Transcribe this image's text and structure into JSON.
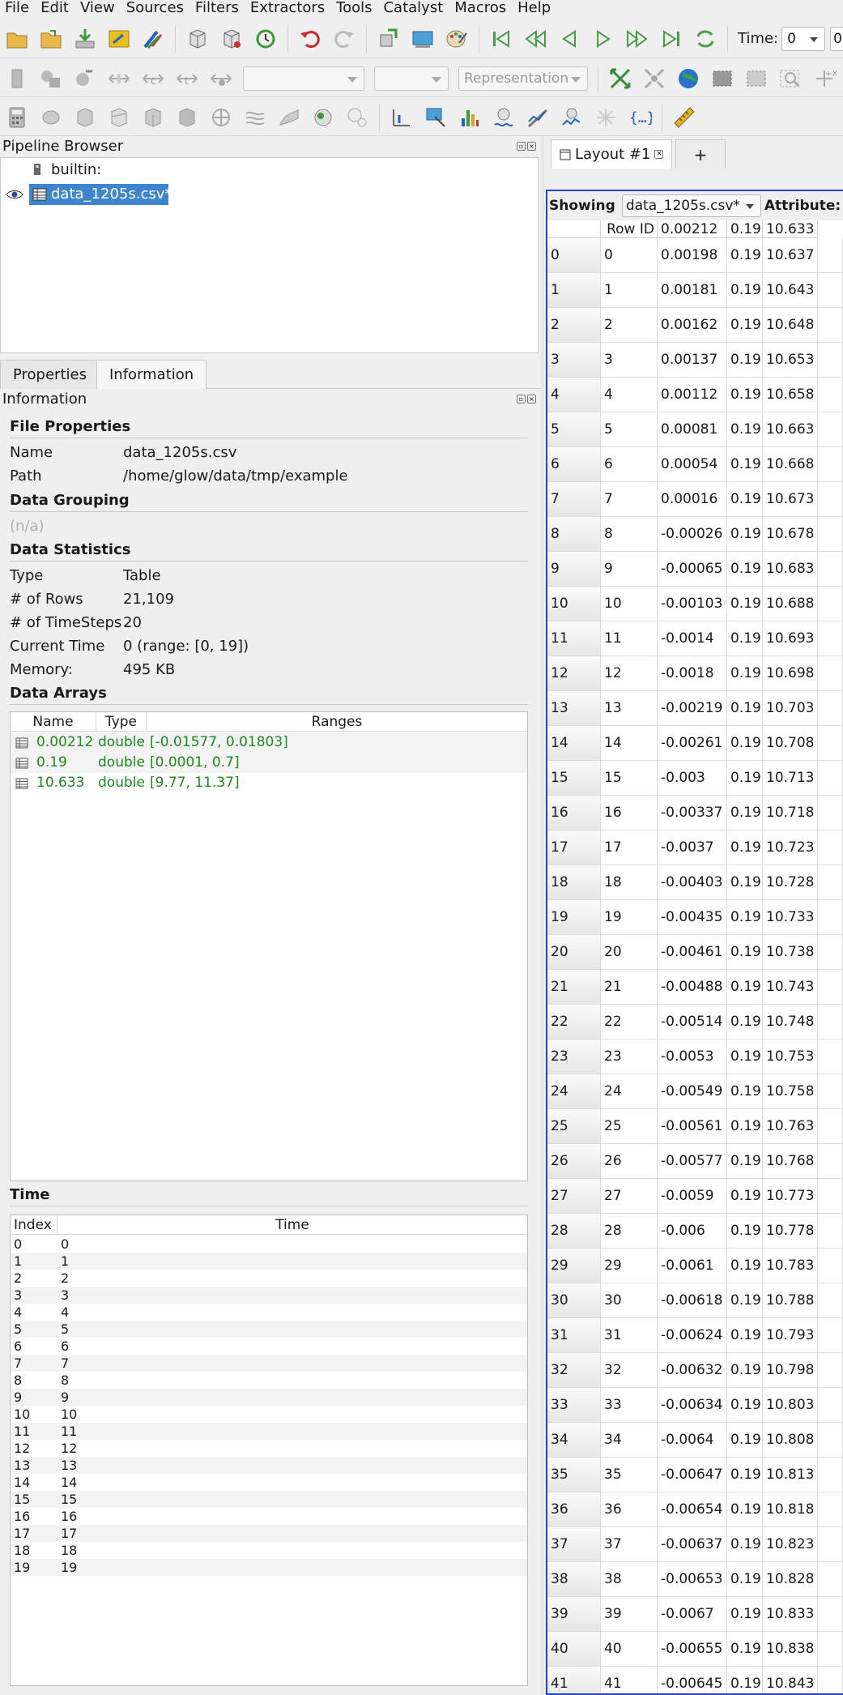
{
  "menu": [
    "File",
    "Edit",
    "View",
    "Sources",
    "Filters",
    "Extractors",
    "Tools",
    "Catalyst",
    "Macros",
    "Help"
  ],
  "toolbar": {
    "time_label": "Time:",
    "time_value": "0",
    "time_spin_value": "0",
    "representation_placeholder": "Representation"
  },
  "colors": {
    "accent_blue": "#2040d0",
    "selection": "#3d86cf",
    "array_green": "#1a8a1a",
    "undo_red": "#cc2a2a"
  },
  "pipeline": {
    "title": "Pipeline Browser",
    "items": [
      {
        "label": "builtin:"
      },
      {
        "label": "data_1205s.csv*"
      }
    ]
  },
  "tabs": [
    "Properties",
    "Information"
  ],
  "information": {
    "title": "Information",
    "file_properties": {
      "title": "File Properties",
      "name_key": "Name",
      "name_value": "data_1205s.csv",
      "path_key": "Path",
      "path_value": "/home/glow/data/tmp/example"
    },
    "data_grouping": {
      "title": "Data Grouping",
      "value": "(n/a)"
    },
    "data_statistics": {
      "title": "Data Statistics",
      "rows": [
        {
          "key": "Type",
          "value": "Table"
        },
        {
          "key": "# of Rows",
          "value": "21,109"
        },
        {
          "key": "# of TimeSteps",
          "value": "20"
        },
        {
          "key": "Current Time",
          "value": "0 (range: [0, 19])"
        },
        {
          "key": "Memory:",
          "value": "495 KB"
        }
      ]
    },
    "data_arrays": {
      "title": "Data Arrays",
      "headers": [
        "Name",
        "Type",
        "Ranges"
      ],
      "rows": [
        {
          "name": "0.00212",
          "type": "double",
          "range": "[-0.01577, 0.01803]"
        },
        {
          "name": "0.19",
          "type": "double",
          "range": "[0.0001, 0.7]"
        },
        {
          "name": "10.633",
          "type": "double",
          "range": "[9.77, 11.37]"
        }
      ]
    },
    "time": {
      "title": "Time",
      "headers": [
        "Index",
        "Time"
      ],
      "rows": [
        [
          "0",
          "0"
        ],
        [
          "1",
          "1"
        ],
        [
          "2",
          "2"
        ],
        [
          "3",
          "3"
        ],
        [
          "4",
          "4"
        ],
        [
          "5",
          "5"
        ],
        [
          "6",
          "6"
        ],
        [
          "7",
          "7"
        ],
        [
          "8",
          "8"
        ],
        [
          "9",
          "9"
        ],
        [
          "10",
          "10"
        ],
        [
          "11",
          "11"
        ],
        [
          "12",
          "12"
        ],
        [
          "13",
          "13"
        ],
        [
          "14",
          "14"
        ],
        [
          "15",
          "15"
        ],
        [
          "16",
          "16"
        ],
        [
          "17",
          "17"
        ],
        [
          "18",
          "18"
        ],
        [
          "19",
          "19"
        ]
      ]
    }
  },
  "layout": {
    "tab_label": "Layout #1",
    "add_tab": "+",
    "showing_label": "Showing",
    "showing_value": "data_1205s.csv*",
    "attribute_label": "Attribute:",
    "table_headers": [
      "",
      "Row ID",
      "0.00212",
      "0.19",
      "10.633"
    ],
    "rows": [
      [
        "0",
        "0",
        "0.00198",
        "0.19",
        "10.637"
      ],
      [
        "1",
        "1",
        "0.00181",
        "0.19",
        "10.643"
      ],
      [
        "2",
        "2",
        "0.00162",
        "0.19",
        "10.648"
      ],
      [
        "3",
        "3",
        "0.00137",
        "0.19",
        "10.653"
      ],
      [
        "4",
        "4",
        "0.00112",
        "0.19",
        "10.658"
      ],
      [
        "5",
        "5",
        "0.00081",
        "0.19",
        "10.663"
      ],
      [
        "6",
        "6",
        "0.00054",
        "0.19",
        "10.668"
      ],
      [
        "7",
        "7",
        "0.00016",
        "0.19",
        "10.673"
      ],
      [
        "8",
        "8",
        "-0.00026",
        "0.19",
        "10.678"
      ],
      [
        "9",
        "9",
        "-0.00065",
        "0.19",
        "10.683"
      ],
      [
        "10",
        "10",
        "-0.00103",
        "0.19",
        "10.688"
      ],
      [
        "11",
        "11",
        "-0.0014",
        "0.19",
        "10.693"
      ],
      [
        "12",
        "12",
        "-0.0018",
        "0.19",
        "10.698"
      ],
      [
        "13",
        "13",
        "-0.00219",
        "0.19",
        "10.703"
      ],
      [
        "14",
        "14",
        "-0.00261",
        "0.19",
        "10.708"
      ],
      [
        "15",
        "15",
        "-0.003",
        "0.19",
        "10.713"
      ],
      [
        "16",
        "16",
        "-0.00337",
        "0.19",
        "10.718"
      ],
      [
        "17",
        "17",
        "-0.0037",
        "0.19",
        "10.723"
      ],
      [
        "18",
        "18",
        "-0.00403",
        "0.19",
        "10.728"
      ],
      [
        "19",
        "19",
        "-0.00435",
        "0.19",
        "10.733"
      ],
      [
        "20",
        "20",
        "-0.00461",
        "0.19",
        "10.738"
      ],
      [
        "21",
        "21",
        "-0.00488",
        "0.19",
        "10.743"
      ],
      [
        "22",
        "22",
        "-0.00514",
        "0.19",
        "10.748"
      ],
      [
        "23",
        "23",
        "-0.0053",
        "0.19",
        "10.753"
      ],
      [
        "24",
        "24",
        "-0.00549",
        "0.19",
        "10.758"
      ],
      [
        "25",
        "25",
        "-0.00561",
        "0.19",
        "10.763"
      ],
      [
        "26",
        "26",
        "-0.00577",
        "0.19",
        "10.768"
      ],
      [
        "27",
        "27",
        "-0.0059",
        "0.19",
        "10.773"
      ],
      [
        "28",
        "28",
        "-0.006",
        "0.19",
        "10.778"
      ],
      [
        "29",
        "29",
        "-0.0061",
        "0.19",
        "10.783"
      ],
      [
        "30",
        "30",
        "-0.00618",
        "0.19",
        "10.788"
      ],
      [
        "31",
        "31",
        "-0.00624",
        "0.19",
        "10.793"
      ],
      [
        "32",
        "32",
        "-0.00632",
        "0.19",
        "10.798"
      ],
      [
        "33",
        "33",
        "-0.00634",
        "0.19",
        "10.803"
      ],
      [
        "34",
        "34",
        "-0.0064",
        "0.19",
        "10.808"
      ],
      [
        "35",
        "35",
        "-0.00647",
        "0.19",
        "10.813"
      ],
      [
        "36",
        "36",
        "-0.00654",
        "0.19",
        "10.818"
      ],
      [
        "37",
        "37",
        "-0.00637",
        "0.19",
        "10.823"
      ],
      [
        "38",
        "38",
        "-0.00653",
        "0.19",
        "10.828"
      ],
      [
        "39",
        "39",
        "-0.0067",
        "0.19",
        "10.833"
      ],
      [
        "40",
        "40",
        "-0.00655",
        "0.19",
        "10.838"
      ],
      [
        "41",
        "41",
        "-0.00645",
        "0.19",
        "10.843"
      ]
    ]
  }
}
